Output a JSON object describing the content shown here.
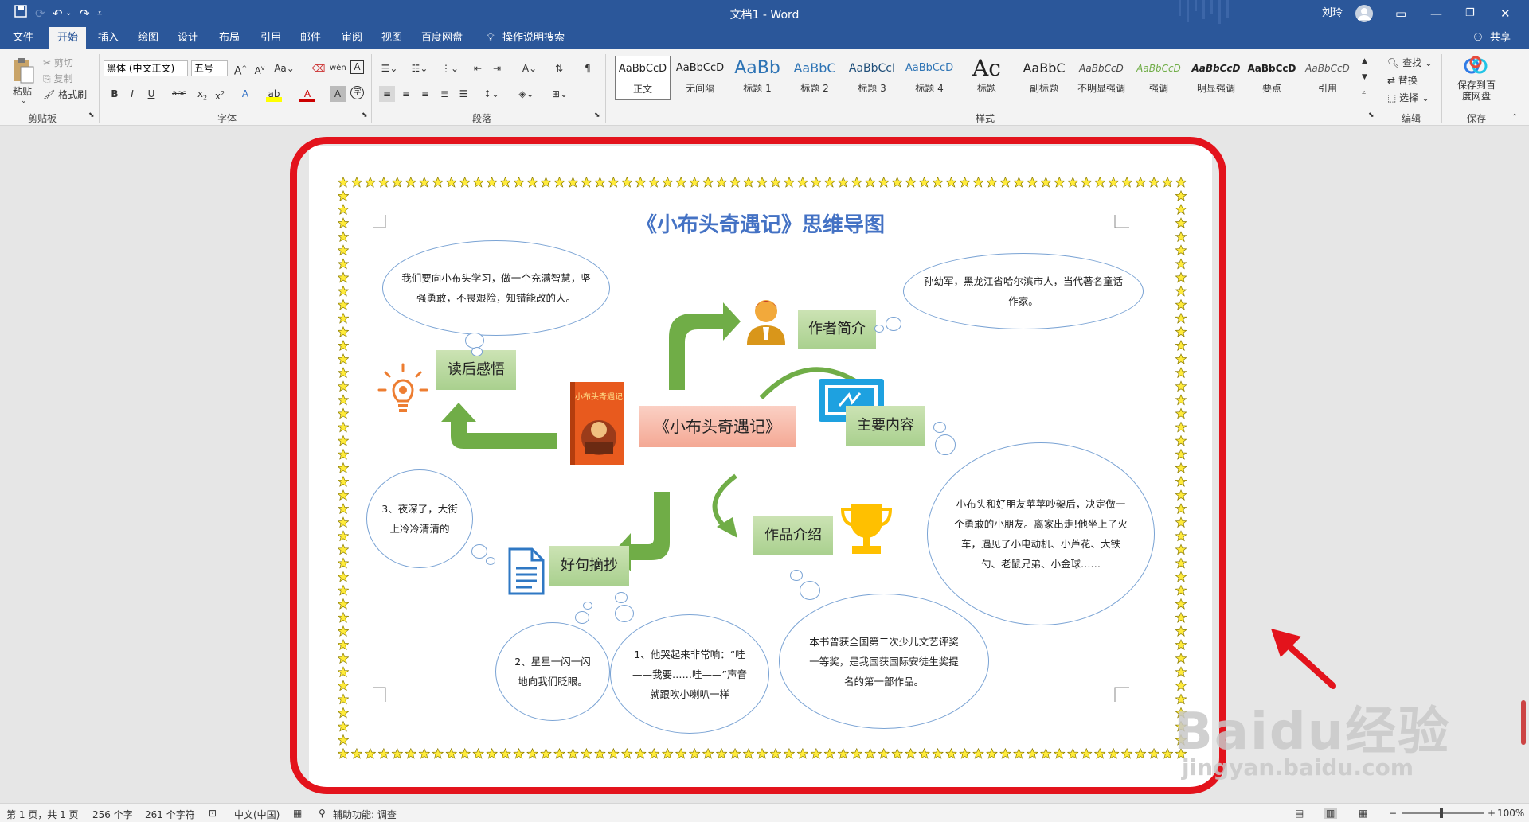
{
  "titlebar": {
    "title": "文档1 - Word",
    "user": "刘玲",
    "save_icon": "save-icon",
    "undo_icon": "undo-icon"
  },
  "tabs": [
    "文件",
    "开始",
    "插入",
    "绘图",
    "设计",
    "布局",
    "引用",
    "邮件",
    "审阅",
    "视图",
    "百度网盘"
  ],
  "tell_me": "操作说明搜索",
  "share": "共享",
  "ribbon": {
    "clipboard": {
      "paste": "粘贴",
      "cut": "剪切",
      "copy": "复制",
      "format_painter": "格式刷",
      "label": "剪贴板"
    },
    "font": {
      "name": "黑体 (中文正文)",
      "size": "五号",
      "label": "字体"
    },
    "paragraph": {
      "label": "段落"
    },
    "styles": {
      "label": "样式",
      "items": [
        {
          "sample": "AaBbCcD",
          "name": "正文"
        },
        {
          "sample": "AaBbCcD",
          "name": "无间隔"
        },
        {
          "sample": "AaBb",
          "name": "标题 1"
        },
        {
          "sample": "AaBbC",
          "name": "标题 2"
        },
        {
          "sample": "AaBbCcI",
          "name": "标题 3"
        },
        {
          "sample": "AaBbCcD",
          "name": "标题 4"
        },
        {
          "sample": "Ac",
          "name": "标题"
        },
        {
          "sample": "AaBbC",
          "name": "副标题"
        },
        {
          "sample": "AaBbCcD",
          "name": "不明显强调"
        },
        {
          "sample": "AaBbCcD",
          "name": "强调"
        },
        {
          "sample": "AaBbCcD",
          "name": "明显强调"
        },
        {
          "sample": "AaBbCcD",
          "name": "要点"
        },
        {
          "sample": "AaBbCcD",
          "name": "引用"
        }
      ]
    },
    "editing": {
      "find": "查找",
      "replace": "替换",
      "select": "选择",
      "label": "编辑"
    },
    "save": {
      "button": "保存到百度网盘",
      "label": "保存"
    }
  },
  "document": {
    "title": "《小布头奇遇记》思维导图",
    "center": "《小布头奇遇记》",
    "book_cover_title": "小布头奇遇记",
    "nodes": {
      "author": "作者简介",
      "content": "主要内容",
      "works": "作品介绍",
      "quotes": "好句摘抄",
      "reflection": "读后感悟"
    },
    "clouds": {
      "reflection": "我们要向小布头学习，做一个充满智慧，坚强勇敢，不畏艰险，知错能改的人。",
      "author": "孙幼军，黑龙江省哈尔滨市人，当代著名童话作家。",
      "content": "小布头和好朋友苹苹吵架后，决定做一个勇敢的小朋友。离家出走!他坐上了火车，遇见了小电动机、小芦花、大铁勺、老鼠兄弟、小金球……",
      "works": "本书曾获全国第二次少儿文艺评奖一等奖，是我国获国际安徒生奖提名的第一部作品。",
      "quote1": "1、他哭起来非常响：“哇——我要……哇——”声音就跟吹小喇叭一样",
      "quote2": "2、星星一闪一闪地向我们眨眼。",
      "quote3": "3、夜深了，大街上冷冷清清的"
    }
  },
  "status": {
    "page": "第 1 页，共 1 页",
    "words": "256 个字",
    "chars": "261 个字符",
    "lang": "中文(中国)",
    "accessibility": "辅助功能: 调查",
    "zoom": "100%"
  },
  "watermark": {
    "brand": "Baidu经验",
    "url": "jingyan.baidu.com"
  },
  "colors": {
    "accent": "#2b579a",
    "frame": "#e3131c",
    "node_green": "#a9d08e",
    "node_pink": "#f4a894",
    "arrow": "#70ad47",
    "title_blue": "#4472c4"
  }
}
